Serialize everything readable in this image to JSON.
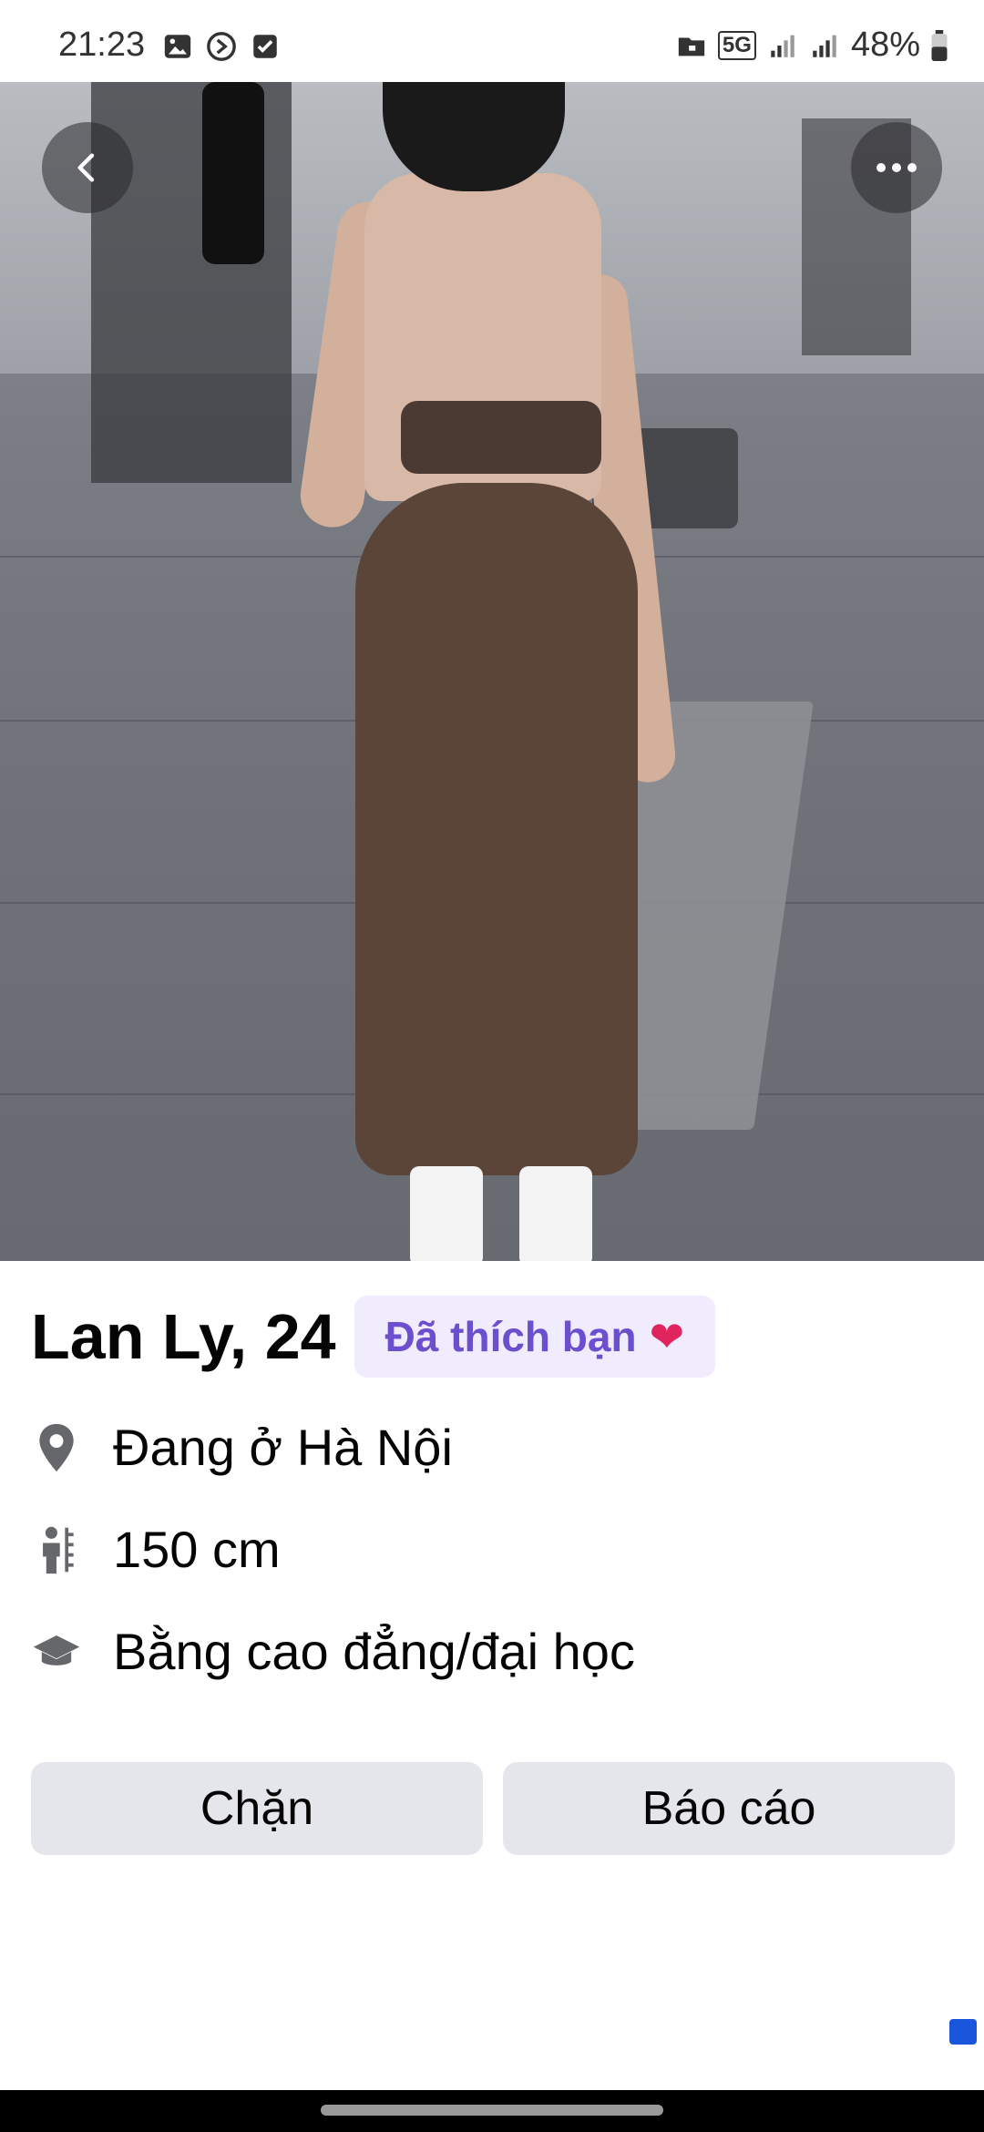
{
  "status_bar": {
    "time": "21:23",
    "network": "5G",
    "battery": "48%",
    "left_icons": [
      "image-icon",
      "timer-icon",
      "checkbox-icon"
    ],
    "right_icons": [
      "folder-lock-icon",
      "5g-icon",
      "signal-icon",
      "signal-icon",
      "battery-icon"
    ]
  },
  "photo": {
    "description_icons": [
      "back-arrow-icon",
      "more-dots-icon"
    ]
  },
  "profile": {
    "name_age": "Lan Ly, 24",
    "liked_badge": "Đã thích bạn",
    "liked_badge_icon": "heart-icon",
    "location": "Đang ở Hà Nội",
    "height": "150 cm",
    "education": "Bằng cao đẳng/đại học"
  },
  "actions": {
    "block_label": "Chặn",
    "report_label": "Báo cáo"
  },
  "colors": {
    "badge_bg": "#f0ebfd",
    "badge_text": "#6b4fcf",
    "button_bg": "#e4e6eb"
  }
}
